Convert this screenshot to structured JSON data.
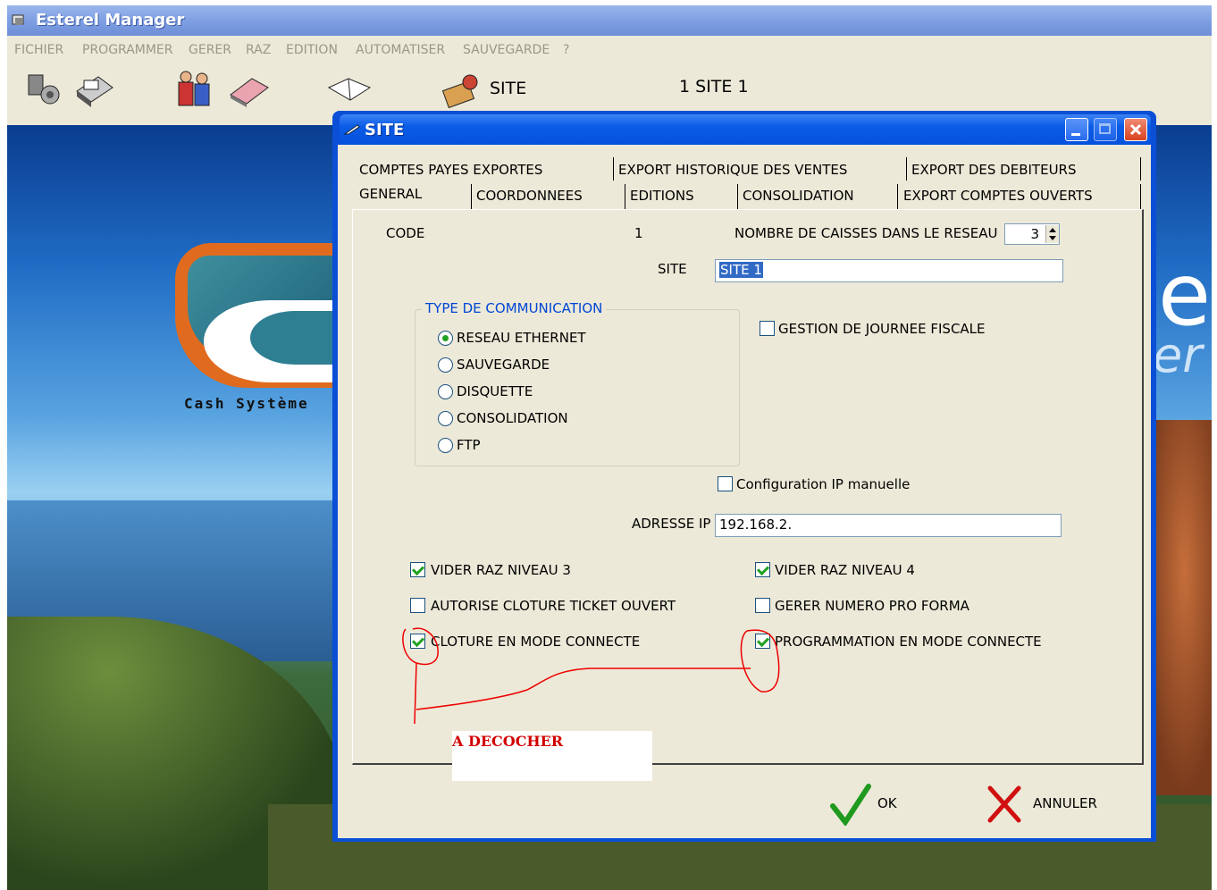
{
  "app": {
    "title": "Esterel Manager"
  },
  "menu": [
    "FICHIER",
    "PROGRAMMER",
    "GERER",
    "RAZ",
    "EDITION",
    "AUTOMATISER",
    "SAUVEGARDE",
    "?"
  ],
  "toolbar": {
    "site_label": "SITE",
    "current_site": "1 SITE 1"
  },
  "background": {
    "logo_text": "Cash Système",
    "brand_big": "el",
    "brand_sub": "er"
  },
  "dialog": {
    "title": "SITE",
    "tabs_row1": [
      "COMPTES PAYES EXPORTES",
      "EXPORT HISTORIQUE DES VENTES",
      "EXPORT DES DEBITEURS"
    ],
    "tabs_row2": [
      "GENERAL",
      "COORDONNEES",
      "EDITIONS",
      "CONSOLIDATION",
      "EXPORT COMPTES OUVERTS"
    ],
    "code_label": "CODE",
    "code_value": "1",
    "nb_caisses_label": "NOMBRE DE CAISSES DANS LE RESEAU",
    "nb_caisses_value": "3",
    "site_label": "SITE",
    "site_value": "SITE 1",
    "comm_group_title": "TYPE DE COMMUNICATION",
    "comm_options": [
      "RESEAU ETHERNET",
      "SAUVEGARDE",
      "DISQUETTE",
      "CONSOLIDATION",
      "FTP"
    ],
    "comm_selected": "RESEAU ETHERNET",
    "gestion_journee": {
      "label": "GESTION DE JOURNEE FISCALE",
      "checked": false
    },
    "config_ip": {
      "label": "Configuration IP manuelle",
      "checked": false
    },
    "ip_label": "ADRESSE IP",
    "ip_value": "192.168.2.",
    "checks": {
      "vider_raz3": {
        "label": "VIDER RAZ NIVEAU 3",
        "checked": true
      },
      "vider_raz4": {
        "label": "VIDER RAZ NIVEAU 4",
        "checked": true
      },
      "autorise_cloture": {
        "label": "AUTORISE CLOTURE TICKET OUVERT",
        "checked": false
      },
      "gerer_proforma": {
        "label": "GERER NUMERO PRO FORMA",
        "checked": false
      },
      "cloture_connecte": {
        "label": "CLOTURE EN MODE CONNECTE",
        "checked": true
      },
      "prog_connecte": {
        "label": "PROGRAMMATION EN MODE CONNECTE",
        "checked": true
      }
    },
    "annotation": "A DECOCHER",
    "ok_label": "OK",
    "cancel_label": "ANNULER"
  }
}
